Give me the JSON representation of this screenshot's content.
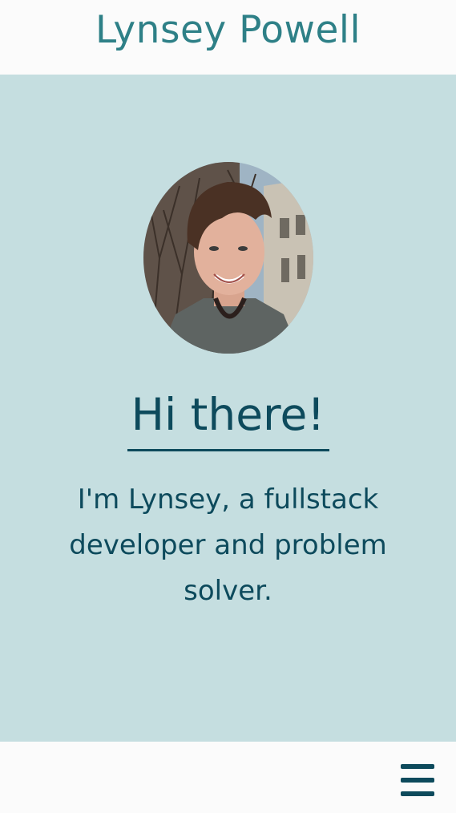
{
  "header": {
    "site_title": "Lynsey Powell"
  },
  "hero": {
    "portrait_icon": "profile-photo",
    "greeting": "Hi there!",
    "intro": "I'm Lynsey, a fullstack developer and problem solver."
  },
  "footer": {
    "menu_icon": "hamburger-menu-icon"
  },
  "colors": {
    "header_bg": "#fbfbfb",
    "hero_bg": "#c5dee0",
    "title_teal": "#2e8087",
    "text_dark": "#0d4a5c"
  }
}
